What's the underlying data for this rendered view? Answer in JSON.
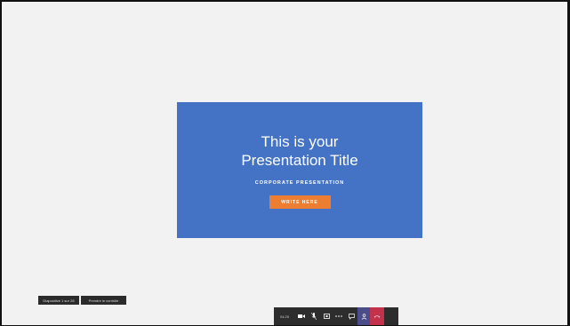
{
  "slide": {
    "title_line1": "This is your",
    "title_line2": "Presentation Title",
    "subtitle": "CORPORATE PRESENTATION",
    "button_label": "WRITE HERE",
    "colors": {
      "background": "#4472c4",
      "button": "#ed7d31"
    }
  },
  "status": {
    "page_indicator": "Diapositive 1 sur 28",
    "take_control": "Prendre le contrôle"
  },
  "toolbar": {
    "timer": "04:25",
    "icons": [
      "video-camera-icon",
      "microphone-off-icon",
      "share-screen-icon",
      "more-options-icon",
      "chat-icon",
      "participants-icon",
      "hang-up-icon"
    ],
    "colors": {
      "bar": "#2d2d2d",
      "active": "#4b4d8a",
      "hangup": "#c4314b"
    }
  }
}
